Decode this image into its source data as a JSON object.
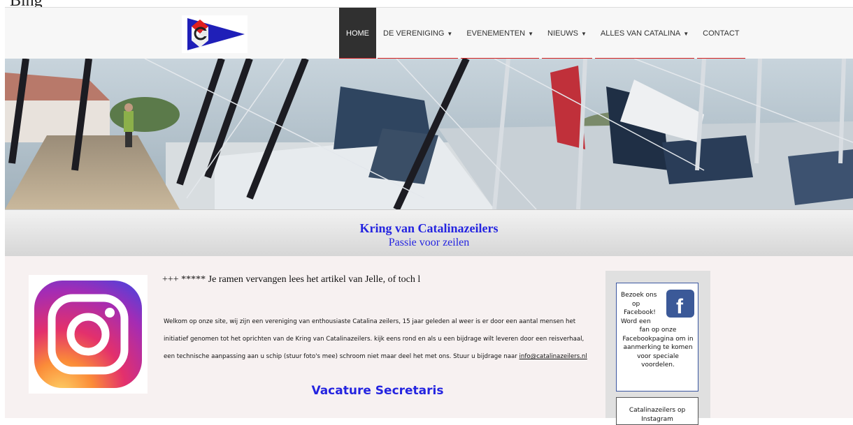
{
  "page_top_text": "Bing",
  "header": {
    "logo_alt": "Kring van Catalinazeilers burgee",
    "nav": [
      {
        "label": "HOME",
        "active": true,
        "dropdown": false
      },
      {
        "label": "DE VERENIGING",
        "active": false,
        "dropdown": true
      },
      {
        "label": "EVENEMENTEN",
        "active": false,
        "dropdown": true
      },
      {
        "label": "NIEUWS",
        "active": false,
        "dropdown": true
      },
      {
        "label": "ALLES VAN CATALINA",
        "active": false,
        "dropdown": true
      },
      {
        "label": "CONTACT",
        "active": false,
        "dropdown": false
      }
    ],
    "accent_color": "#d42020"
  },
  "hero": {
    "alt": "Marina with sailboats moored along a wooden jetty"
  },
  "band": {
    "title": "Kring van Catalinazeilers",
    "tagline": "Passie voor zeilen",
    "color": "#2424e0"
  },
  "main": {
    "ticker": "+++   ***** Je ramen vervangen lees het artikel van Jelle, of toch l",
    "welcome_text": "Welkom op onze site, wij zijn een vereniging van enthousiaste Catalina zeilers, 15 jaar geleden al weer is er door een aantal mensen het initiatief genomen tot het oprichten van de Kring van Catalinazeilers. kijk eens rond en als u een bijdrage wilt leveren door een reisverhaal, een technische aanpassing aan u schip  (stuur foto's mee) schroom niet maar deel het met ons. Stuur u bijdrage naar ",
    "email": "info@catalinazeilers.nl",
    "heading": "Vacature Secretaris"
  },
  "sidebar": {
    "facebook_lines": [
      "Bezoek ons",
      "op",
      "Facebook!",
      "Word een",
      "fan op onze Facebookpagina om in aanmerking te komen voor speciale voordelen."
    ],
    "instagram_text": "Catalinazeilers op Instagram"
  },
  "icons": [
    "instagram-icon",
    "facebook-icon",
    "caret-down-icon"
  ]
}
